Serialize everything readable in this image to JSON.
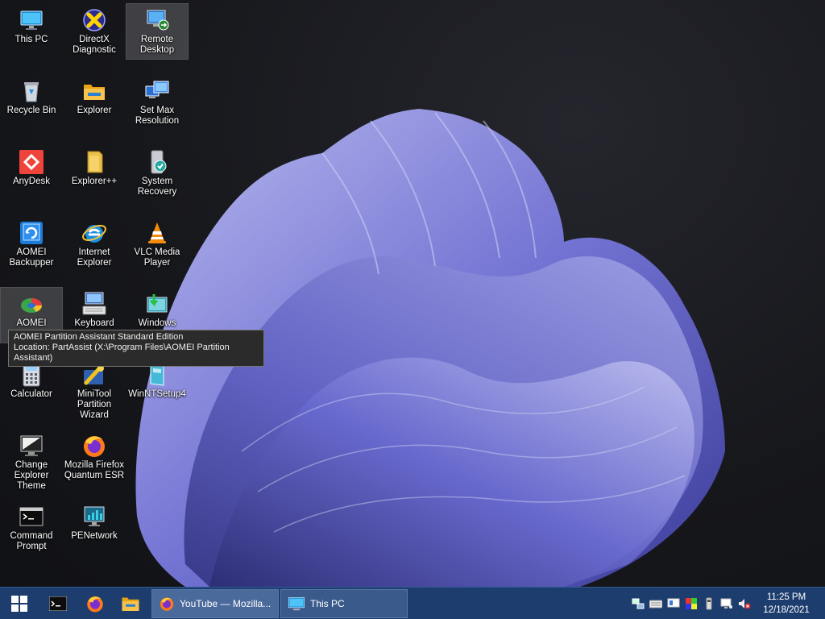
{
  "desktop": {
    "icons": [
      {
        "label": "This PC",
        "icon": "monitor-icon"
      },
      {
        "label": "DirectX Diagnostic",
        "icon": "directx-icon"
      },
      {
        "label": "Remote Desktop",
        "icon": "remote-desktop-icon"
      },
      {
        "label": "Recycle Bin",
        "icon": "recycle-bin-icon"
      },
      {
        "label": "Explorer",
        "icon": "folder-icon"
      },
      {
        "label": "Set Max Resolution",
        "icon": "display-settings-icon"
      },
      {
        "label": "AnyDesk",
        "icon": "anydesk-icon"
      },
      {
        "label": "Explorer++",
        "icon": "folder-plus-icon"
      },
      {
        "label": "System Recovery",
        "icon": "system-recovery-icon"
      },
      {
        "label": "AOMEI Backupper",
        "icon": "backupper-icon"
      },
      {
        "label": "Internet Explorer",
        "icon": "internet-explorer-icon"
      },
      {
        "label": "VLC Media Player",
        "icon": "vlc-icon"
      },
      {
        "label": "AOMEI",
        "icon": "partition-assistant-icon"
      },
      {
        "label": "Keyboard",
        "icon": "keyboard-icon"
      },
      {
        "label": "Windows",
        "icon": "windows-install-icon"
      },
      {
        "label": "Calculator",
        "icon": "calculator-icon"
      },
      {
        "label": "MiniTool Partition Wizard",
        "icon": "minitool-icon"
      },
      {
        "label": "WinNTSetup4",
        "icon": "winntsetup-icon"
      },
      {
        "label": "Change Explorer Theme",
        "icon": "theme-monitor-icon"
      },
      {
        "label": "Mozilla Firefox Quantum ESR",
        "icon": "firefox-icon"
      },
      {
        "label": "Command Prompt",
        "icon": "command-prompt-icon"
      },
      {
        "label": "PENetwork",
        "icon": "network-icon"
      }
    ]
  },
  "tooltip": {
    "line1": "AOMEI Partition Assistant Standard Edition",
    "line2": "Location: PartAssist (X:\\Program Files\\AOMEI Partition Assistant)"
  },
  "taskbar": {
    "start_icon": "windows-logo-icon",
    "pinned": [
      "command-prompt-icon",
      "firefox-icon",
      "folder-icon"
    ],
    "tasks": [
      {
        "label": "YouTube — Mozilla...",
        "icon": "firefox-icon"
      },
      {
        "label": "This PC",
        "icon": "monitor-icon"
      }
    ],
    "tray": [
      "network-status-icon",
      "keyboard-icon",
      "display-icon",
      "color-icon",
      "usb-icon",
      "monitor-net-icon",
      "volume-muted-icon"
    ],
    "time": "11:25 PM",
    "date": "12/18/2021"
  },
  "colors": {
    "taskbar": "#1d3d6e",
    "bloom": "#6e6fcf",
    "tooltip_bg": "#2b2b2b"
  }
}
